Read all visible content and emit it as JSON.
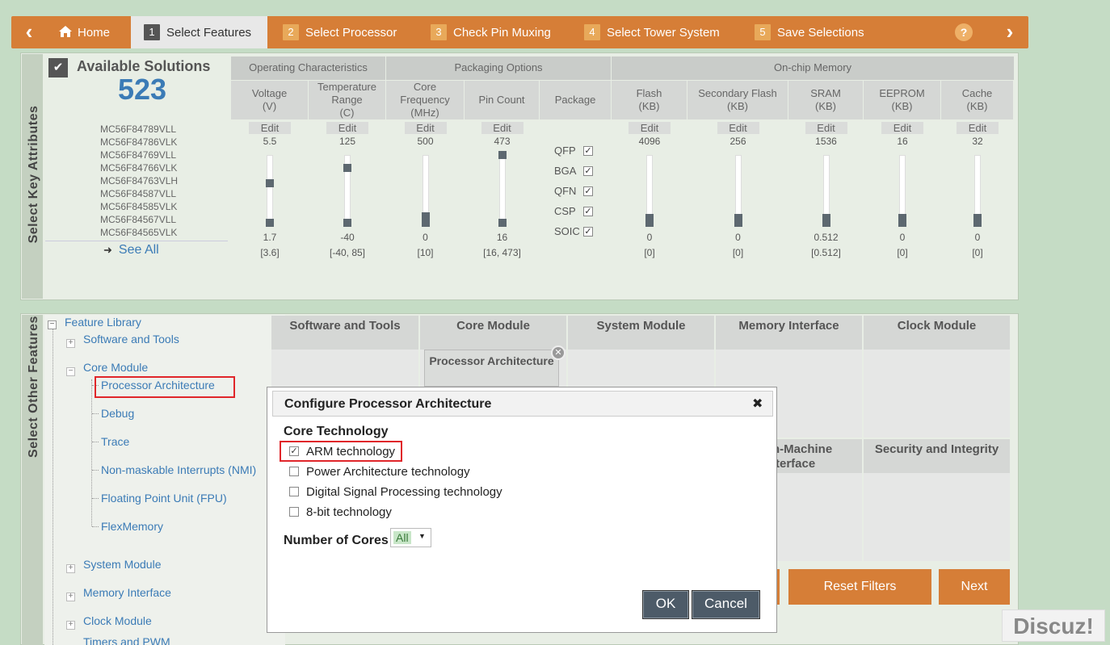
{
  "nav": {
    "home": "Home",
    "steps": [
      {
        "num": "1",
        "label": "Select Features"
      },
      {
        "num": "2",
        "label": "Select Processor"
      },
      {
        "num": "3",
        "label": "Check Pin Muxing"
      },
      {
        "num": "4",
        "label": "Select Tower System"
      },
      {
        "num": "5",
        "label": "Save Selections"
      }
    ],
    "help": "?",
    "prev": "‹",
    "next": "›"
  },
  "key_attrs": {
    "side_title": "Select Key Attributes",
    "available_label": "Available Solutions",
    "count": "523",
    "parts": [
      "MC56F84789VLL",
      "MC56F84786VLK",
      "MC56F84769VLL",
      "MC56F84766VLK",
      "MC56F84763VLH",
      "MC56F84587VLL",
      "MC56F84585VLK",
      "MC56F84567VLL",
      "MC56F84565VLK"
    ],
    "see_all": "See All",
    "groups": [
      "Operating Characteristics",
      "Packaging Options",
      "On-chip Memory"
    ],
    "edit_label": "Edit",
    "columns": [
      {
        "h1": "Voltage",
        "h2": "(V)",
        "h3": "",
        "max": "5.5",
        "min": "1.7",
        "range": "[3.6]",
        "pos_top": 0.45,
        "pos_bot": 1.0
      },
      {
        "h1": "Temperature",
        "h2": "Range",
        "h3": "(C)",
        "max": "125",
        "min": "-40",
        "range": "[-40, 85]",
        "pos_top": 0.2,
        "pos_bot": 1.0
      },
      {
        "h1": "Core",
        "h2": "Frequency",
        "h3": "(MHz)",
        "max": "500",
        "min": "0",
        "range": "[10]",
        "pos_top": 0.98,
        "pos_bot": 1.0
      },
      {
        "h1": "Pin Count",
        "h2": "",
        "h3": "",
        "max": "473",
        "min": "16",
        "range": "[16, 473]",
        "pos_top": 0.0,
        "pos_bot": 1.0
      },
      {
        "h1": "Flash",
        "h2": "(KB)",
        "h3": "",
        "max": "4096",
        "min": "0",
        "range": "[0]",
        "pos_top": 1.0,
        "pos_bot": 1.0
      },
      {
        "h1": "Secondary Flash",
        "h2": "(KB)",
        "h3": "",
        "max": "256",
        "min": "0",
        "range": "[0]",
        "pos_top": 1.0,
        "pos_bot": 1.0
      },
      {
        "h1": "SRAM",
        "h2": "(KB)",
        "h3": "",
        "max": "1536",
        "min": "0.512",
        "range": "[0.512]",
        "pos_top": 1.0,
        "pos_bot": 1.0
      },
      {
        "h1": "EEPROM",
        "h2": "(KB)",
        "h3": "",
        "max": "16",
        "min": "0",
        "range": "[0]",
        "pos_top": 1.0,
        "pos_bot": 1.0
      },
      {
        "h1": "Cache",
        "h2": "(KB)",
        "h3": "",
        "max": "32",
        "min": "0",
        "range": "[0]",
        "pos_top": 1.0,
        "pos_bot": 1.0
      }
    ],
    "package_header": "Package",
    "packages": [
      "QFP",
      "BGA",
      "QFN",
      "CSP",
      "SOIC"
    ]
  },
  "features": {
    "side_title": "Select Other Features",
    "tree": {
      "root": "Feature Library",
      "software": "Software and Tools",
      "core": "Core Module",
      "core_children": [
        "Processor Architecture",
        "Debug",
        "Trace",
        "Non-maskable Interrupts (NMI)",
        "Floating Point Unit (FPU)",
        "FlexMemory"
      ],
      "system": "System Module",
      "memory": "Memory Interface",
      "clock": "Clock Module",
      "cut": "Timers and PWM"
    },
    "modules": [
      "Software and Tools",
      "Core Module",
      "System Module",
      "Memory Interface",
      "Clock Module"
    ],
    "module_row2": [
      "Human-Machine Interface",
      "Security and Integrity"
    ],
    "hmi_visible": "n-Machine",
    "hmi_visible2": "terface",
    "selected_card": "Processor Architecture",
    "reset": "Reset Filters",
    "next": "Next"
  },
  "dialog": {
    "title": "Configure Processor Architecture",
    "close": "✖",
    "section": "Core Technology",
    "options": [
      {
        "label": "ARM technology",
        "checked": true
      },
      {
        "label": "Power Architecture technology",
        "checked": false
      },
      {
        "label": "Digital Signal Processing technology",
        "checked": false
      },
      {
        "label": "8-bit technology",
        "checked": false
      }
    ],
    "cores_label": "Number of Cores",
    "cores_value": "All",
    "ok": "OK",
    "cancel": "Cancel"
  },
  "watermark": "Discuz!",
  "colors": {
    "accent": "#d67e37",
    "link": "#3b7bb6",
    "count": "#3b7bb6",
    "highlight": "#e0262a"
  }
}
